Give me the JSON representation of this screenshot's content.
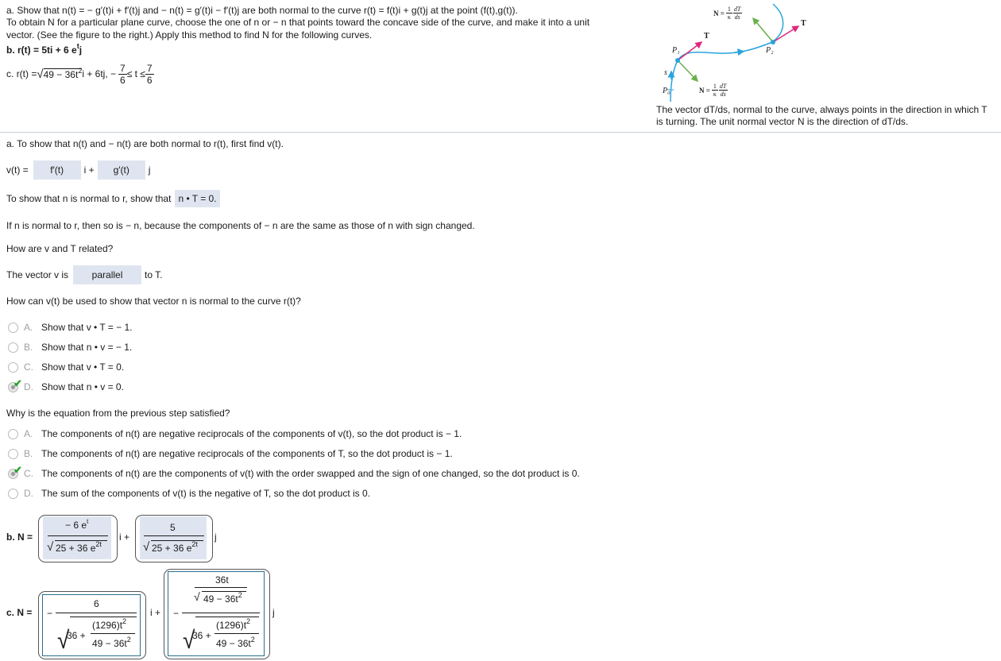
{
  "problem": {
    "line1_prefix": "a. Show that ",
    "line1": "n(t) = − g′(t)i + f′(t)j and − n(t) = g′(t)i − f′(t)j are both normal to the curve r(t) = f(t)i + g(t)j at the point (f(t),g(t)).",
    "line2": "To obtain N for a particular plane curve, choose the one of n or − n that points toward the concave side of the curve, and make it into a unit",
    "line3": "vector. (See the figure to the right.) Apply this method to find N for the following curves.",
    "part_b_label": "b.",
    "part_b": "r(t) = 5ti + 6 e",
    "part_b_sup": "t",
    "part_b_end": "j",
    "part_c_label": "c.",
    "part_c_pre": "r(t) = ",
    "part_c_sqrt": "49 − 36t",
    "part_c_sq": "2",
    "part_c_mid": " i + 6tj,  −",
    "part_c_frac_num": "7",
    "part_c_frac_den": "6",
    "part_c_le": " ≤ t ≤ ",
    "part_c_frac2_num": "7",
    "part_c_frac2_den": "6"
  },
  "figure": {
    "label_N_top": "N =",
    "label_kappa": "κ",
    "label_one": "1",
    "label_dT": "dT",
    "label_ds": "ds",
    "label_T1": "T",
    "label_T2": "T",
    "label_P0": "P₀",
    "label_P1": "P₁",
    "label_P2": "P₂",
    "label_s": "s",
    "caption_line1": "The vector dT/ds, normal to the curve, always points in the direction in which T",
    "caption_line2": "is turning. The unit normal vector N is the direction of dT/ds.",
    "colors": {
      "curve": "#29a3dd",
      "tangent": "#e0287a",
      "normal": "#6ab04c"
    }
  },
  "section_a": {
    "intro": "a. To show that n(t) and − n(t) are both normal to r(t), first find v(t).",
    "v_label": "v(t) =",
    "v_answer_i": "f′(t)",
    "v_i": "i +",
    "v_answer_j": "g′(t)",
    "v_j": "j",
    "show_normal_prefix": "To show that n is normal to r, show that",
    "show_normal_answer": "n • T = 0.",
    "neg_n_text": "If n is normal to r, then so is − n, because the components of − n are the same as those of n with sign changed.",
    "relation_question": "How are v and T related?",
    "relation_prefix": "The vector v is",
    "relation_answer": "parallel",
    "relation_suffix": "to T.",
    "question1": "How can v(t) be used to show that vector n is normal to the curve r(t)?",
    "q1_options": [
      {
        "letter": "A.",
        "text": "Show that v • T = − 1.",
        "selected": false
      },
      {
        "letter": "B.",
        "text": "Show that n • v = − 1.",
        "selected": false
      },
      {
        "letter": "C.",
        "text": "Show that v • T = 0.",
        "selected": false
      },
      {
        "letter": "D.",
        "text": "Show that n • v = 0.",
        "selected": true
      }
    ],
    "question2": "Why is the equation from the previous step satisfied?",
    "q2_options": [
      {
        "letter": "A.",
        "text": "The components of n(t) are negative reciprocals of the components of v(t), so the dot product is − 1.",
        "selected": false
      },
      {
        "letter": "B.",
        "text": "The components of n(t) are negative reciprocals of the components of T, so the dot product is − 1.",
        "selected": false
      },
      {
        "letter": "C.",
        "text": "The components of n(t) are the components of v(t) with the order swapped and the sign of one changed, so the dot product is 0.",
        "selected": true
      },
      {
        "letter": "D.",
        "text": "The sum of the components of v(t) is the negative of T, so the dot product is 0.",
        "selected": false
      }
    ]
  },
  "section_b": {
    "label": "b. N =",
    "i_num": "− 6 e",
    "i_num_sup": "t",
    "den_sqrt": "25 + 36 e",
    "den_sup": "2t",
    "i_suffix": "i +",
    "j_num": "5",
    "j_suffix": "j"
  },
  "section_c": {
    "label": "c. N =",
    "i_sign": "−",
    "i_num": "6",
    "den_36": "36 +",
    "den_frac_num": "(1296)t",
    "den_frac_num_sup": "2",
    "den_frac_den": "49 − 36t",
    "den_frac_den_sup": "2",
    "i_suffix": "i +",
    "j_sign": "−",
    "j_num_top": "36t",
    "j_num_sqrt": "49 − 36t",
    "j_num_sqrt_sup": "2",
    "j_suffix": "j"
  },
  "colors": {
    "answer_bg": "#dfe5f0",
    "check": "#2aa12a",
    "boxed_border": "#2c6e8e",
    "divider": "#c8d0d6"
  }
}
